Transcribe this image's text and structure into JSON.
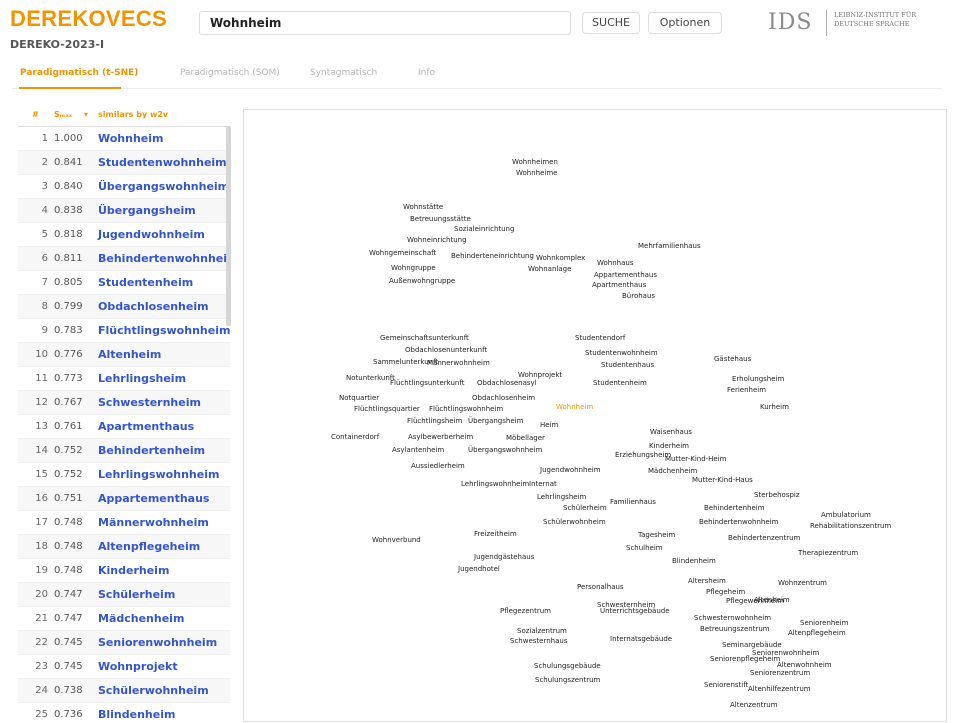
{
  "header": {
    "logo": "DEREKOVECS",
    "corpus": "DEREKO-2023-I",
    "search_value": "Wohnheim",
    "search_button": "SUCHE",
    "options_button": "Optionen",
    "ids_logo": "IDS",
    "ids_text": "LEIBNIZ-INSTITUT FÜR DEUTSCHE SPRACHE"
  },
  "tabs": [
    {
      "label": "Paradigmatisch (t-SNE)",
      "active": true
    },
    {
      "label": "Paradigmatisch (SOM)",
      "active": false
    },
    {
      "label": "Syntagmatisch",
      "active": false
    },
    {
      "label": "Info",
      "active": false
    }
  ],
  "table": {
    "col_num": "#",
    "col_sim": "Sₘₐₓ",
    "col_word": "similars by w2v",
    "rows": [
      {
        "n": "1",
        "s": "1.000",
        "w": "Wohnheim"
      },
      {
        "n": "2",
        "s": "0.841",
        "w": "Studentenwohnheim"
      },
      {
        "n": "3",
        "s": "0.840",
        "w": "Übergangswohnheim"
      },
      {
        "n": "4",
        "s": "0.838",
        "w": "Übergangsheim"
      },
      {
        "n": "5",
        "s": "0.818",
        "w": "Jugendwohnheim"
      },
      {
        "n": "6",
        "s": "0.811",
        "w": "Behindertenwohnheim"
      },
      {
        "n": "7",
        "s": "0.805",
        "w": "Studentenheim"
      },
      {
        "n": "8",
        "s": "0.799",
        "w": "Obdachlosenheim"
      },
      {
        "n": "9",
        "s": "0.783",
        "w": "Flüchtlingswohnheim"
      },
      {
        "n": "10",
        "s": "0.776",
        "w": "Altenheim"
      },
      {
        "n": "11",
        "s": "0.773",
        "w": "Lehrlingsheim"
      },
      {
        "n": "12",
        "s": "0.767",
        "w": "Schwesternheim"
      },
      {
        "n": "13",
        "s": "0.761",
        "w": "Apartmenthaus"
      },
      {
        "n": "14",
        "s": "0.752",
        "w": "Behindertenheim"
      },
      {
        "n": "15",
        "s": "0.752",
        "w": "Lehrlingswohnheim"
      },
      {
        "n": "16",
        "s": "0.751",
        "w": "Appartementhaus"
      },
      {
        "n": "17",
        "s": "0.748",
        "w": "Männerwohnheim"
      },
      {
        "n": "18",
        "s": "0.748",
        "w": "Altenpflegeheim"
      },
      {
        "n": "19",
        "s": "0.748",
        "w": "Kinderheim"
      },
      {
        "n": "20",
        "s": "0.747",
        "w": "Schülerheim"
      },
      {
        "n": "21",
        "s": "0.747",
        "w": "Mädchenheim"
      },
      {
        "n": "22",
        "s": "0.745",
        "w": "Seniorenwohnheim"
      },
      {
        "n": "23",
        "s": "0.745",
        "w": "Wohnprojekt"
      },
      {
        "n": "24",
        "s": "0.738",
        "w": "Schülerwohnheim"
      },
      {
        "n": "25",
        "s": "0.736",
        "w": "Blindenheim"
      }
    ]
  },
  "map_labels": [
    "Wohnheimen",
    "Wohnheime",
    "Wohnstätte",
    "Betreuungsstätte",
    "Sozialeinrichtung",
    "Wohneinrichtung",
    "Wohngemeinschaft",
    "Behinderteneinrichtung",
    "Wohnkomplex",
    "Wohnhaus",
    "Mehrfamilienhaus",
    "Wohngruppe",
    "Wohnanlage",
    "Appartementhaus",
    "Außenwohngruppe",
    "Apartmenthaus",
    "Bürohaus",
    "Gemeinschaftsunterkunft",
    "Studentendorf",
    "Obdachlosenunterkunft",
    "Studentenwohnheim",
    "Sammelunterkunft",
    "Männerwohnheim",
    "Studentenhaus",
    "Gästehaus",
    "Notunterkunft",
    "Wohnprojekt",
    "Flüchtlingsunterkunft",
    "Obdachlosenasyl",
    "Studentenheim",
    "Erholungsheim",
    "Notquartier",
    "Obdachlosenheim",
    "Ferienheim",
    "Flüchtlingsquartier",
    "Flüchtlingswohnheim",
    "Wohnheim",
    "Kurheim",
    "Flüchtlingsheim",
    "Übergangsheim",
    "Heim",
    "Containerdorf",
    "Asylbewerberheim",
    "Möbellager",
    "Waisenhaus",
    "Asylantenheim",
    "Übergangswohnheim",
    "Kinderheim",
    "Erziehungsheim",
    "Mutter-Kind-Heim",
    "Aussiedlerheim",
    "Jugendwohnheim",
    "Mädchenheim",
    "Lehrlingswohnheim",
    "Internat",
    "Mutter-Kind-Haus",
    "Lehrlingsheim",
    "Familienhaus",
    "Sterbehospiz",
    "Schülerheim",
    "Behindertenheim",
    "Ambulatorium",
    "Schülerwohnheim",
    "Behindertenwohnheim",
    "Rehabilitationszentrum",
    "Freizeitheim",
    "Tagesheim",
    "Behindertenzentrum",
    "Wohnverbund",
    "Schulheim",
    "Therapiezentrum",
    "Jugendgästehaus",
    "Blindenheim",
    "Jugendhotel",
    "Personalhaus",
    "Altersheim",
    "Wohnzentrum",
    "Pflegeheim",
    "Pflegewohnheim",
    "Schwesternheim",
    "Altenheim",
    "Pflegezentrum",
    "Unterrichtsgebäude",
    "Schwesternwohnheim",
    "Seniorenheim",
    "Betreuungszentrum",
    "Altenpflegeheim",
    "Sozialzentrum",
    "Internatsgebäude",
    "Schwesternhaus",
    "Seminargebäude",
    "Seniorenwohnheim",
    "Seniorenpflegeheim",
    "Altenwohnheim",
    "Schulungsgebäude",
    "Seniorenzentrum",
    "Schulungszentrum",
    "Seniorenstift",
    "Altenhilfezentrum",
    "Altenzentrum"
  ],
  "highlight_word": "Wohnheim",
  "colors": {
    "accent": "#f29400",
    "link": "#3355cc"
  }
}
